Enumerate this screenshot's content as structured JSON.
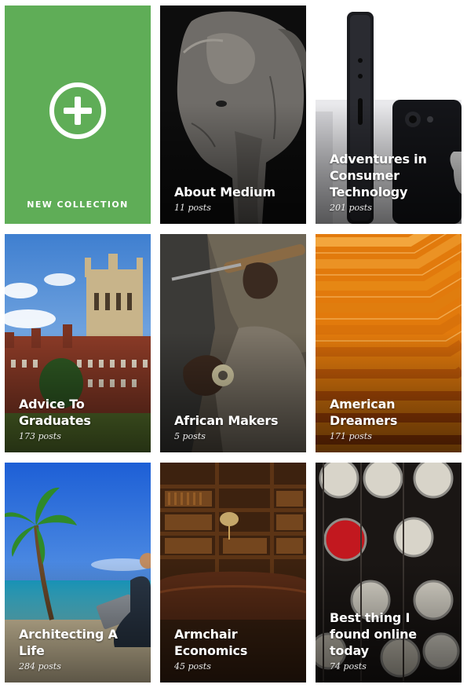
{
  "new_collection": {
    "label": "NEW COLLECTION",
    "icon": "plus-circle-icon",
    "color": "#5fad57"
  },
  "collections": [
    {
      "title": "About Medium",
      "count": "11 posts"
    },
    {
      "title": "Adventures in Consumer Technology",
      "count": "201 posts"
    },
    {
      "title": "Advice To Graduates",
      "count": "173 posts"
    },
    {
      "title": "African Makers",
      "count": "5 posts"
    },
    {
      "title": "American Dreamers",
      "count": "171 posts"
    },
    {
      "title": "Architecting A Life",
      "count": "284 posts"
    },
    {
      "title": "Armchair Economics",
      "count": "45 posts"
    },
    {
      "title": "Best thing I found online today",
      "count": "74 posts"
    }
  ]
}
